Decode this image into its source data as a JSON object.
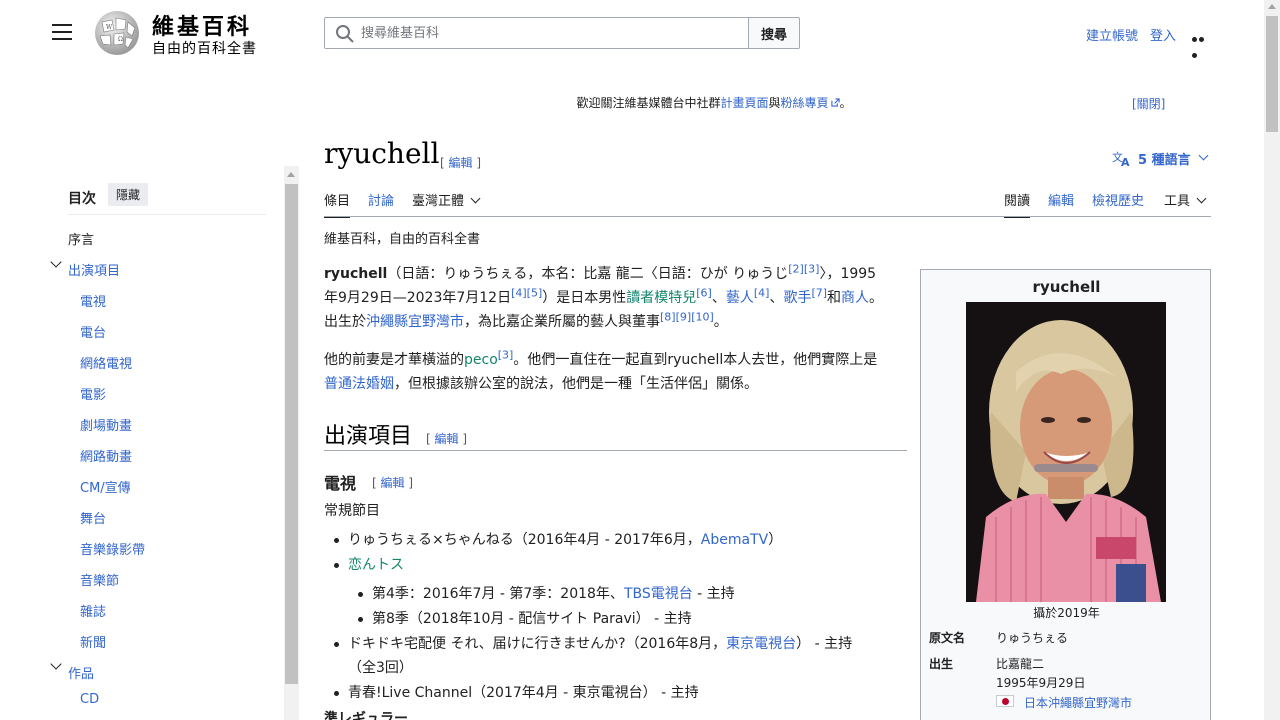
{
  "header": {
    "wordmark": "維基百科",
    "tagline": "自由的百科全書",
    "search_placeholder": "搜尋維基百科",
    "search_button": "搜尋",
    "create_account": "建立帳號",
    "login": "登入"
  },
  "banner": {
    "text_before": "歡迎關注維基媒體台中社群",
    "link1": "計畫頁面",
    "conj": "與",
    "link2": "粉絲專頁",
    "text_after": "。",
    "close": "[關閉]"
  },
  "toc": {
    "title": "目次",
    "hide": "隱藏",
    "items": [
      {
        "label": "序言",
        "level": 0
      },
      {
        "label": "出演項目",
        "level": 0
      },
      {
        "label": "電視",
        "level": 1
      },
      {
        "label": "電台",
        "level": 1
      },
      {
        "label": "網絡電視",
        "level": 1
      },
      {
        "label": "電影",
        "level": 1
      },
      {
        "label": "劇場動畫",
        "level": 1
      },
      {
        "label": "網路動畫",
        "level": 1
      },
      {
        "label": "CM/宣傳",
        "level": 1
      },
      {
        "label": "舞台",
        "level": 1
      },
      {
        "label": "音樂錄影帶",
        "level": 1
      },
      {
        "label": "音樂節",
        "level": 1
      },
      {
        "label": "雜誌",
        "level": 1
      },
      {
        "label": "新聞",
        "level": 1
      },
      {
        "label": "作品",
        "level": 0
      },
      {
        "label": "CD",
        "level": 1
      }
    ]
  },
  "article": {
    "title": "ryuchell",
    "edit_link": "[ 編輯 ]",
    "languages": "5 種語言",
    "tabs": {
      "article": "條目",
      "talk": "討論",
      "variant": "臺灣正體",
      "read": "閱讀",
      "edit": "編輯",
      "history": "檢視歷史",
      "tools": "工具"
    },
    "from_wiki": "維基百科，自由的百科全書",
    "p1": {
      "name": "ryuchell",
      "t1": "（日語：りゅうちぇる，本名：比嘉 龍二〈日語：ひが りゅうじ",
      "r1": "[2]",
      "r2": "[3]",
      "t2": "〉，1995",
      "t3": "年9月29日—2023年7月12日",
      "r3": "[4]",
      "r4": "[5]",
      "t4": "）是日本男性",
      "link_model": "讀者模特兒",
      "r5": "[6]",
      "sep1": "、",
      "link_artist": "藝人",
      "r6": "[4]",
      "sep2": "、",
      "link_singer": "歌手",
      "r7": "[7]",
      "t5": "和",
      "link_merchant": "商人",
      "t6": "。",
      "t7": "出生於",
      "link_birthplace": "沖繩縣宜野灣市",
      "t8": "，為比嘉企業所屬的藝人與董事",
      "r8": "[8]",
      "r9": "[9]",
      "r10": "[10]",
      "t9": "。"
    },
    "p2": {
      "t1": "他的前妻是才華橫溢的",
      "link_peco": "peco",
      "r1": "[3]",
      "t2": "。他們一直住在一起直到ryuchell本人去世，他們實際上是",
      "link_marriage": "普通法婚姻",
      "t3": "，但根據該辦公室的說法，他們是一種「生活伴侶」關係。"
    },
    "section_title": "出演項目",
    "section_edit": "[ 編輯 ]",
    "subsection_title": "電視",
    "subsection_edit": "[ 編輯 ]",
    "regular_programs": "常規節目",
    "list": {
      "i1_text": "りゅうちぇる×ちゃんねる（2016年4月 - 2017年6月，",
      "i1_link": "AbemaTV",
      "i1_end": "）",
      "i2_link": "恋んトス",
      "i2a_text": "第4季：2016年7月 - 第7季：2018年、",
      "i2a_link": "TBS電視台",
      "i2a_end": " - 主持",
      "i2b_text": "第8季（2018年10月 - 配信サイト Paravi） - 主持",
      "i3_text": "ドキドキ宅配便 それ、届けに行きませんか?（2016年8月，",
      "i3_link": "東京電視台",
      "i3_end": "） - 主持",
      "i3_line2": "（全3回）",
      "i4_text": "青春!Live Channel（2017年4月 - 東京電視台） - 主持"
    },
    "cut_heading": "準レギュラー"
  },
  "infobox": {
    "title": "ryuchell",
    "caption": "攝於2019年",
    "rows": {
      "name_label": "原文名",
      "name_value": "りゅうちぇる",
      "birth_label": "出生",
      "birth_name": "比嘉龍二",
      "birth_date": "1995年9月29日",
      "birth_place": "日本沖繩縣宜野灣市"
    }
  },
  "colors": {
    "link": "#3366cc",
    "visited_green": "#14866d",
    "text": "#202122",
    "border": "#a2a9b1"
  }
}
